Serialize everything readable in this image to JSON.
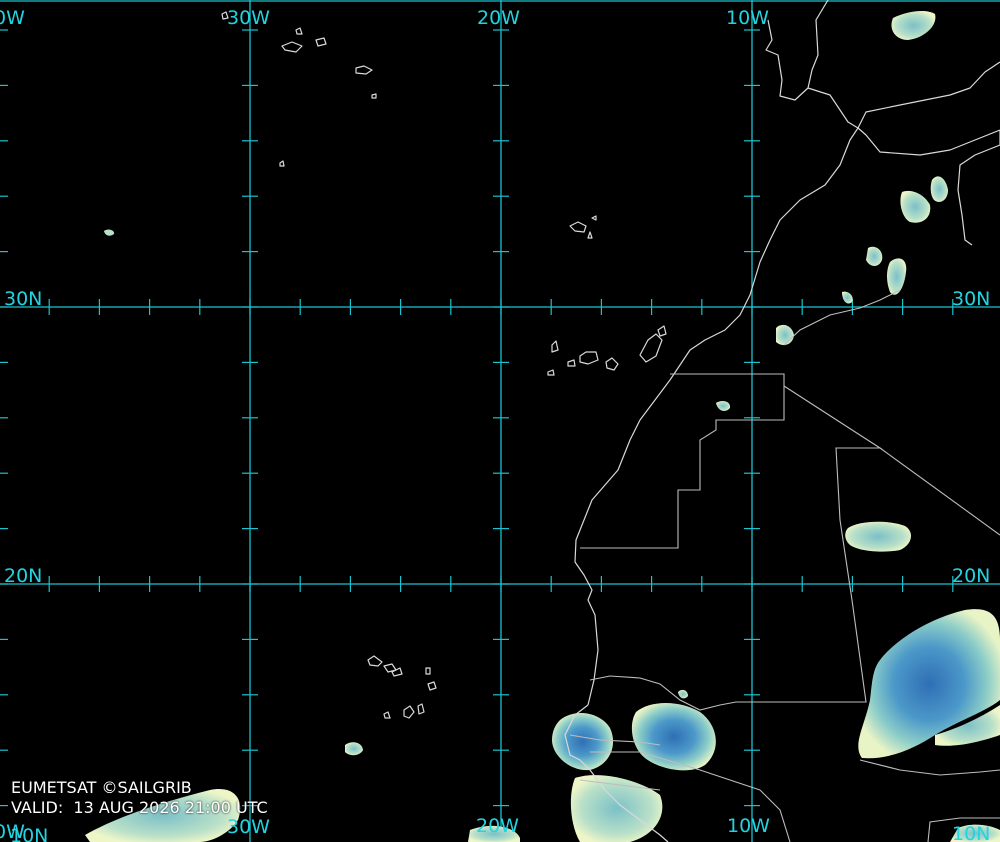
{
  "map": {
    "grid_labels": {
      "lon_top": [
        "0W",
        "30W",
        "20W",
        "10W"
      ],
      "lon_bottom": [
        "0W",
        "30W",
        "20W",
        "10W"
      ],
      "lat_left": [
        "30N",
        "20N",
        "10N"
      ],
      "lat_right": [
        "30N",
        "20N",
        "10N"
      ]
    },
    "colors": {
      "background": "#000000",
      "graticule": "#19c3cf",
      "coastline": "#d9d9d9",
      "cloud_light": "#eef6c8",
      "cloud_mid": "#7fc6c9",
      "cloud_dense": "#2f74b8"
    }
  },
  "credits": {
    "source": "EUMETSAT ©SAILGRIB",
    "valid_label": "VALID:",
    "valid_time": "13 AUG 2026 21:00 UTC"
  }
}
